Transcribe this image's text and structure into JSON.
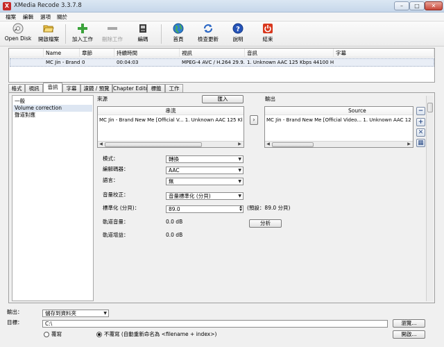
{
  "window": {
    "title": "XMedia Recode 3.3.7.8",
    "app_icon": "X"
  },
  "window_controls": {
    "minimize": "–",
    "maximize": "□",
    "close": "✕"
  },
  "menu": [
    "檔案",
    "編輯",
    "選項",
    "關於"
  ],
  "toolbar": [
    {
      "label": "Open Disk",
      "icon": "disc-icon",
      "enabled": true
    },
    {
      "label": "開啟檔案",
      "icon": "folder-open-icon",
      "enabled": true
    },
    {
      "label": "加入工作",
      "icon": "plus-icon",
      "enabled": true
    },
    {
      "label": "刪除工作",
      "icon": "minus-icon",
      "enabled": false
    },
    {
      "label": "編碼",
      "icon": "encode-icon",
      "enabled": true
    },
    {
      "label": "首頁",
      "icon": "globe-icon",
      "enabled": true
    },
    {
      "label": "檢查更新",
      "icon": "refresh-icon",
      "enabled": true
    },
    {
      "label": "說明",
      "icon": "help-icon",
      "enabled": true
    },
    {
      "label": "結束",
      "icon": "power-icon",
      "enabled": true
    }
  ],
  "file_list": {
    "columns": [
      "Name",
      "章節",
      "持續時間",
      "視訊",
      "音訊",
      "字幕"
    ],
    "rows": [
      [
        "MC Jin - Brand ...",
        "0",
        "00:04:03",
        "MPEG-4 AVC / H.264 29.9...",
        "1. Unknown AAC  125 Kbps 44100 H...",
        ""
      ]
    ]
  },
  "tabs": [
    "格式",
    "視訊",
    "音訊",
    "字幕",
    "濾鏡 / 預覽",
    "Chapter Editor",
    "標籤",
    "工作"
  ],
  "active_tab": "音訊",
  "left_list": {
    "items": [
      "一般",
      "Volume correction",
      "聲道對應"
    ],
    "selected": "Volume correction"
  },
  "source": {
    "title": "來源",
    "import_button": "匯入",
    "column": "串流",
    "row": "MC Jin - Brand New Me [Official V...   1. Unknown AAC  125 Kbps 441..."
  },
  "output": {
    "title": "輸出",
    "column": "Source",
    "row": "MC Jin - Brand New Me [Official Video...   1. Unknown AAC  125 Kbps 44100 H..."
  },
  "transfer_button": "›",
  "side_buttons": [
    {
      "icon": "minus-icon",
      "glyph": "−"
    },
    {
      "icon": "plus-icon",
      "glyph": "+"
    },
    {
      "icon": "close-icon",
      "glyph": "✕"
    },
    {
      "icon": "grid-icon",
      "glyph": "▦"
    }
  ],
  "settings": {
    "mode_label": "模式：",
    "mode_value": "轉換",
    "codec_label": "編解碼器：",
    "codec_value": "AAC",
    "language_label": "語言：",
    "language_value": "無",
    "volume_label": "音量校正：",
    "volume_value": "音量標準化 (分貝)",
    "normalize_label": "標準化 (分貝)：",
    "normalize_value": "89.0",
    "default_text": "(預設：89.0 分貝)",
    "track_volume_label": "軌道音量：",
    "track_volume_value": "0.0 dB",
    "track_gain_label": "軌道增益：",
    "track_gain_value": "0.0 dB",
    "analyze_button": "分析"
  },
  "bottom": {
    "output_label": "輸出：",
    "output_value": "儲存到資料夾",
    "target_label": "目標：",
    "target_value": "C:\\",
    "browse_button": "瀏覽...",
    "open_button": "開啟...",
    "overwrite_label": "覆寫",
    "no_overwrite_label": "不覆寫 (自動重新命名為 <filename + index>)",
    "selected_radio": "no_overwrite"
  }
}
